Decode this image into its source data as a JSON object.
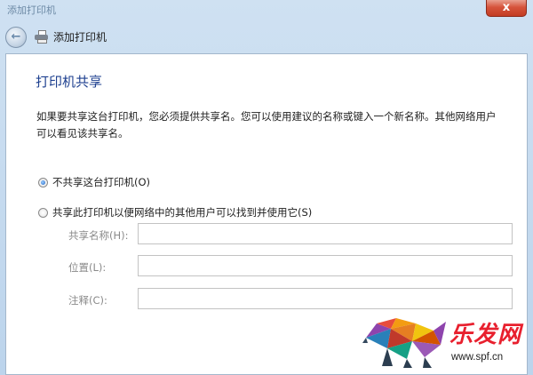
{
  "window": {
    "title": "添加打印机",
    "close_glyph": "x"
  },
  "nav": {
    "back_glyph": "←",
    "wizard_title": "添加打印机"
  },
  "page": {
    "heading": "打印机共享",
    "description": "如果要共享这台打印机，您必须提供共享名。您可以使用建议的名称或键入一个新名称。其他网络用户可以看见该共享名。"
  },
  "options": [
    {
      "label": "不共享这台打印机(O)",
      "checked": true
    },
    {
      "label": "共享此打印机以便网络中的其他用户可以找到并使用它(S)",
      "checked": false
    }
  ],
  "fields": [
    {
      "label": "共享名称(H):",
      "value": ""
    },
    {
      "label": "位置(L):",
      "value": ""
    },
    {
      "label": "注释(C):",
      "value": ""
    }
  ],
  "watermark": {
    "logo_text": "乐发网",
    "url": "www.spf.cn"
  },
  "colors": {
    "heading": "#1d3f8f",
    "chrome": "#c4d8ee",
    "watermark_red": "#e8202e"
  }
}
